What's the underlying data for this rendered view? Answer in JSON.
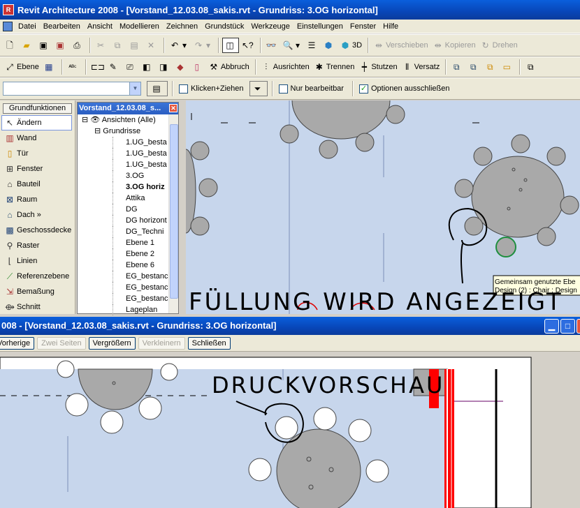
{
  "main_window": {
    "title": "Revit Architecture 2008 - [Vorstand_12.03.08_sakis.rvt - Grundriss: 3.OG horizontal]"
  },
  "menu": [
    "Datei",
    "Bearbeiten",
    "Ansicht",
    "Modellieren",
    "Zeichnen",
    "Grundstück",
    "Werkzeuge",
    "Einstellungen",
    "Fenster",
    "Hilfe"
  ],
  "toolbar1": {
    "tools": [
      "new",
      "open",
      "save",
      "save-all",
      "print",
      "cut",
      "copy",
      "paste",
      "delete",
      "undo",
      "redo",
      "toggle-view",
      "help-cursor",
      "glasses",
      "zoom",
      "down",
      "section",
      "cube",
      "cube-3d"
    ],
    "label_3d": "3D",
    "spiegeln_label": "Verschieben",
    "kopieren_label": "Kopieren",
    "drehen_label": "Drehen"
  },
  "toolbar2": {
    "ebene_label": "Ebene",
    "abbruch_label": "Abbruch",
    "ausrichten_label": "Ausrichten",
    "trennen_label": "Trennen",
    "stutzen_label": "Stutzen",
    "versatz_label": "Versatz"
  },
  "optionsbar": {
    "klicken_label": "Klicken+Ziehen",
    "nur_label": "Nur bearbeitbar",
    "optionen_label": "Optionen ausschließen",
    "klicken_checked": false,
    "nur_checked": false,
    "optionen_checked": true
  },
  "design_bar": {
    "header": "Grundfunktionen",
    "items": [
      "Ändern",
      "Wand",
      "Tür",
      "Fenster",
      "Bauteil",
      "Raum",
      "Dach »",
      "Geschossdecke",
      "Raster",
      "Linien",
      "Referenzebene",
      "Bemaßung",
      "Schnitt"
    ]
  },
  "project_browser": {
    "title": "Vorstand_12.03.08_s...",
    "root": "Ansichten (Alle)",
    "group": "Grundrisse",
    "views": [
      "1.UG_besta",
      "1.UG_besta",
      "1.UG_besta",
      "3.OG",
      "3.OG horiz",
      "Attika",
      "DG",
      "DG horizont",
      "DG_Techni",
      "Ebene 1",
      "Ebene 2",
      "Ebene 6",
      "EG_bestanc",
      "EG_bestanc",
      "EG_bestanc",
      "Lageplan"
    ],
    "active_view": "3.OG horiz"
  },
  "canvas1": {
    "annotation": "FÜLLUNG WIRD ANGEZEIGT",
    "tooltip_line1": "Gemeinsam genutzte Ebe",
    "tooltip_line2": "Design (2) : Chair : Design"
  },
  "preview_window": {
    "title": "008 - [Vorstand_12.03.08_sakis.rvt - Grundriss: 3.OG horizontal]",
    "buttons": [
      {
        "label": "Vorherige",
        "enabled": true
      },
      {
        "label": "Zwei Seiten",
        "enabled": false
      },
      {
        "label": "Vergrößern",
        "enabled": true
      },
      {
        "label": "Verkleinern",
        "enabled": false
      },
      {
        "label": "Schließen",
        "enabled": true
      }
    ],
    "annotation": "DRUCKVORSCHAU"
  },
  "colors": {
    "titlebar": "#0a46b8",
    "canvas": "#c7d6ec",
    "table": "#a9a9a9",
    "red": "#ff0000"
  }
}
